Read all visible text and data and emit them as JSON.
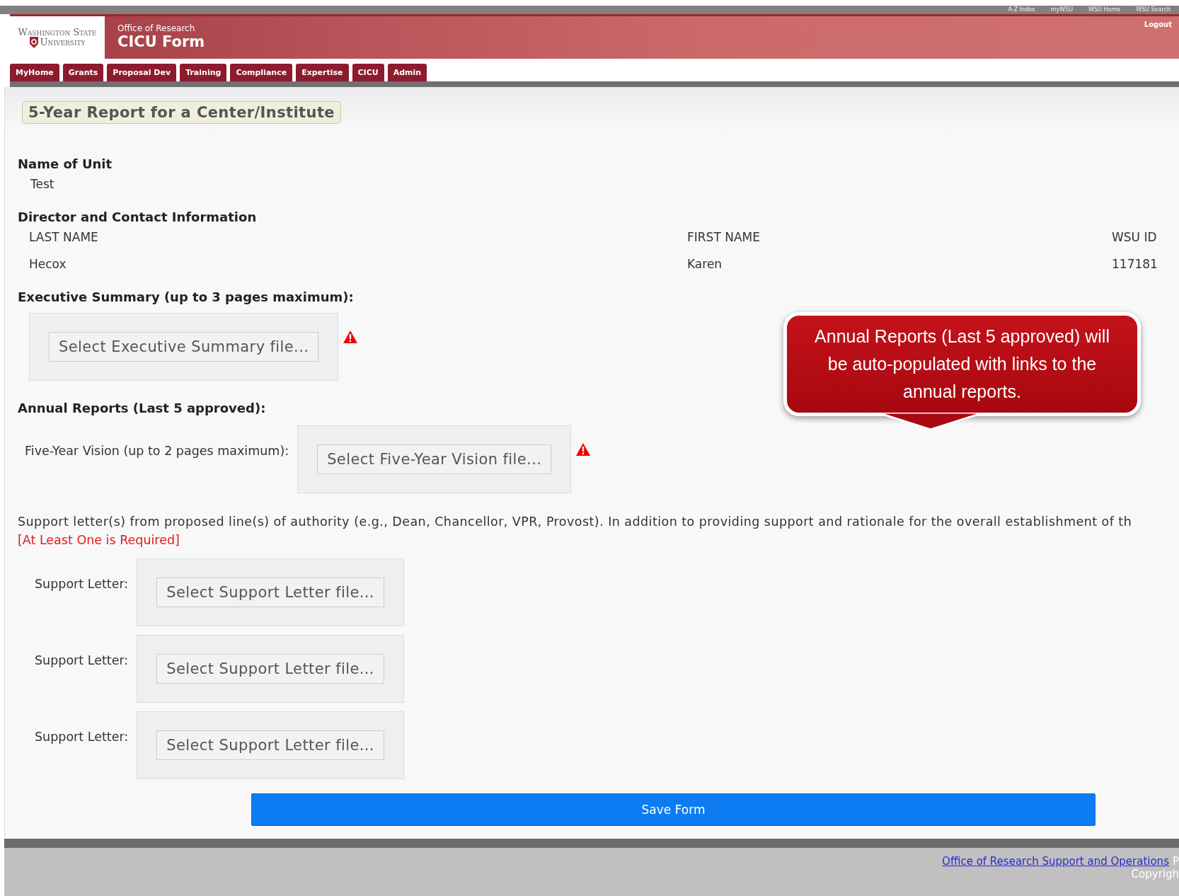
{
  "top_links": [
    "A-Z Index",
    "myWSU",
    "WSU Home",
    "WSU Search"
  ],
  "logo": {
    "line1": "Washington State",
    "line2": "University"
  },
  "header": {
    "subtitle": "Office of Research",
    "title": "CICU Form",
    "logout": "Logout"
  },
  "tabs": [
    "MyHome",
    "Grants",
    "Proposal Dev",
    "Training",
    "Compliance",
    "Expertise",
    "CICU",
    "Admin"
  ],
  "page_title": "5-Year Report for a Center/Institute",
  "unit": {
    "label": "Name of Unit",
    "value": "Test"
  },
  "director": {
    "label": "Director and Contact Information",
    "columns": [
      "LAST NAME",
      "FIRST NAME",
      "WSU ID"
    ],
    "values": [
      "Hecox",
      "Karen",
      "117181"
    ]
  },
  "executive_summary": {
    "label": "Executive Summary (up to 3 pages maximum):",
    "button": "Select Executive Summary file...",
    "warning": true
  },
  "annual_reports": {
    "label": "Annual Reports (Last 5 approved):"
  },
  "vision": {
    "label": "Five-Year Vision (up to 2 pages maximum):",
    "button": "Select Five-Year Vision file...",
    "warning": true
  },
  "support": {
    "text": "Support letter(s) from proposed line(s) of authority (e.g., Dean, Chancellor, VPR, Provost). In addition to providing support and rationale for the overall establishment of th",
    "required": "[At Least One is Required]",
    "letters": [
      {
        "label": "Support Letter:",
        "button": "Select Support Letter file...",
        "warning": false
      },
      {
        "label": "Support Letter:",
        "button": "Select Support Letter file...",
        "warning": false
      },
      {
        "label": "Support Letter:",
        "button": "Select Support Letter file...",
        "warning": false
      }
    ]
  },
  "save_button": "Save Form",
  "callout": "Annual Reports (Last 5 approved) will be auto-populated with links to the annual reports.",
  "footer": {
    "link": "Office of Research Support and Operations",
    "cut_text": "P",
    "copyright": "Copyrigh"
  }
}
